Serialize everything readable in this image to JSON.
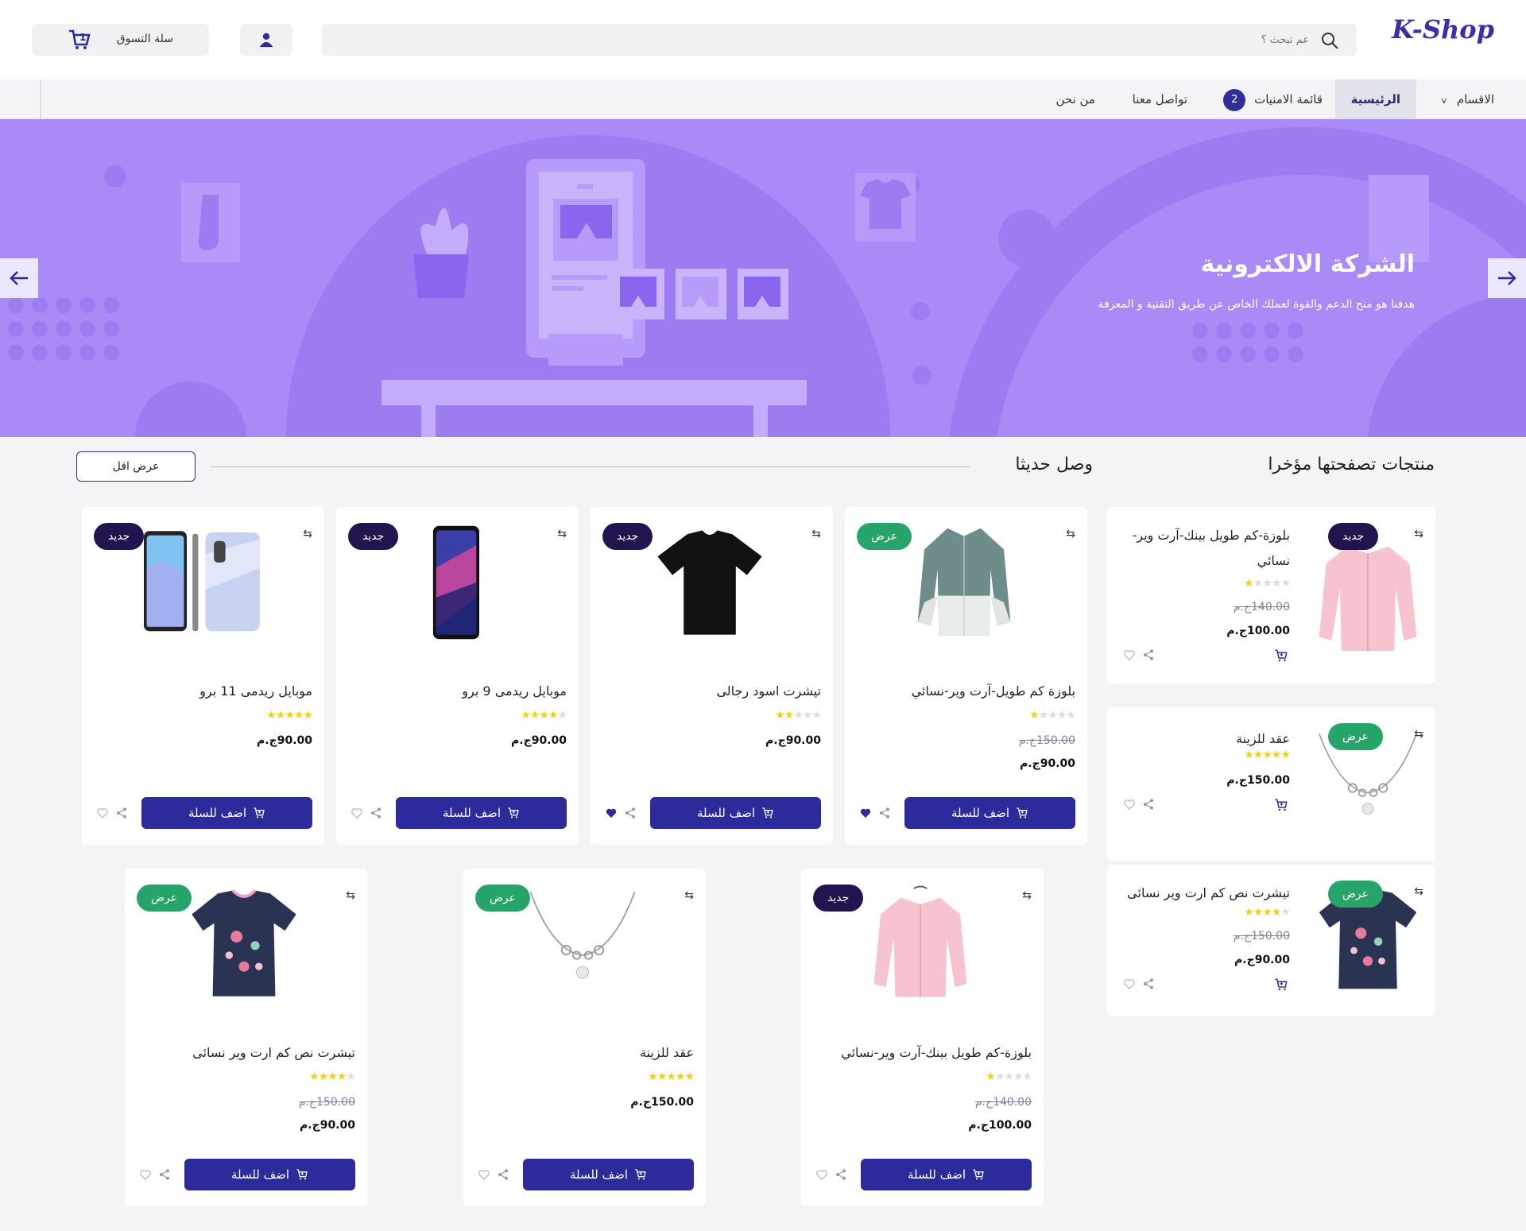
{
  "header": {
    "logo": "K-Shop",
    "search_placeholder": "عم تبحث ؟",
    "cart_label": "سلة التسوق",
    "cart_count": "1"
  },
  "nav": {
    "categories": "الاقسام",
    "home": "الرئيسية",
    "wishlist": "قائمة الامنيات",
    "wishlist_count": "2",
    "contact": "تواصل معنا",
    "about": "من نحن"
  },
  "hero": {
    "title": "الشركة الالكترونية",
    "subtitle": "هدفنا هو منح الدعم والقوة لعملك الخاص عن طريق التقنية و المعرفة",
    "bg_color": "#a98af7"
  },
  "sections": {
    "recent": "منتجات تصفحتها مؤخرا",
    "new_arrivals": "وصل حديثا",
    "show_less": "عرض اقل"
  },
  "labels": {
    "add_to_cart": "اضف للسلة",
    "new": "جديد",
    "offer": "عرض"
  },
  "colors": {
    "primary": "#2d2b9c",
    "new_tag": "#22154f",
    "offer_tag": "#27a46a",
    "star": "#f2d113"
  },
  "new_products": [
    {
      "name": "موبايل ريدمى 11 برو",
      "price": "90.00ج.م",
      "old_price": "",
      "rating": 5,
      "tag": "جديد",
      "liked": false,
      "image": "phone-pair"
    },
    {
      "name": "موبايل ريدمى 9 برو",
      "price": "90.00ج.م",
      "old_price": "",
      "rating": 4,
      "tag": "جديد",
      "liked": false,
      "image": "phone"
    },
    {
      "name": "تيشرت اسود رجالى",
      "price": "90.00ج.م",
      "old_price": "",
      "rating": 2,
      "tag": "جديد",
      "liked": true,
      "image": "tshirt"
    },
    {
      "name": "بلوزة كم طويل-آرت وير-نسائي",
      "price": "90.00ج.م",
      "old_price": "150.00ج.م",
      "rating": 1,
      "tag": "عرض",
      "liked": true,
      "image": "shirt"
    },
    {
      "name": "تيشرت نص كم ارت وير نسائى",
      "price": "90.00ج.م",
      "old_price": "150.00ج.م",
      "rating": 4,
      "tag": "عرض",
      "liked": false,
      "image": "kids-tee"
    },
    {
      "name": "عقد للزينة",
      "price": "150.00ج.م",
      "old_price": "",
      "rating": 5,
      "tag": "عرض",
      "liked": false,
      "image": "necklace"
    },
    {
      "name": "بلوزة-كم طويل بينك-آرت وير-نسائي",
      "price": "100.00ج.م",
      "old_price": "140.00ج.م",
      "rating": 1,
      "tag": "جديد",
      "liked": false,
      "image": "pink"
    }
  ],
  "recent_products": [
    {
      "name": "بلوزة-كم طويل بينك-آرت وير-نسائي",
      "price": "100.00ج.م",
      "old_price": "140.00ج.م",
      "rating": 1,
      "tag": "جديد",
      "image": "pink"
    },
    {
      "name": "عقد للزينة",
      "price": "150.00ج.م",
      "old_price": "",
      "rating": 5,
      "tag": "عرض",
      "image": "necklace"
    },
    {
      "name": "تيشرت نص كم ارت وير نسائى",
      "price": "90.00ج.م",
      "old_price": "150.00ج.م",
      "rating": 4,
      "tag": "عرض",
      "image": "kids-tee"
    }
  ]
}
